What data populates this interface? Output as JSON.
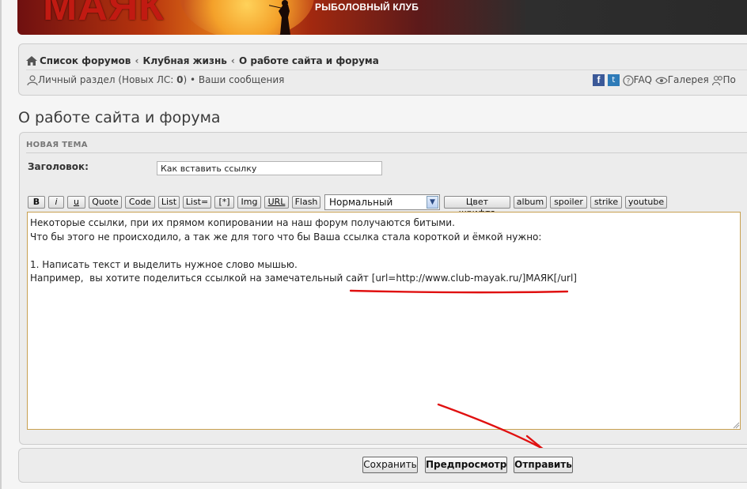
{
  "header": {
    "logo_text": "МАЯК",
    "subtitle": "РЫБОЛОВНЫЙ КЛУБ"
  },
  "breadcrumbs": {
    "items": [
      "Список форумов",
      "Клубная жизнь",
      "О работе сайта и форума"
    ],
    "separator": "‹"
  },
  "userbar": {
    "personal_prefix": "Личный раздел (Новых ЛС: ",
    "new_pm_count": "0",
    "personal_suffix": ")",
    "bullet": "•",
    "my_posts": "Ваши сообщения",
    "faq": "FAQ",
    "gallery": "Галерея",
    "users_truncated": "По"
  },
  "page_title": "О работе сайта и форума",
  "panel": {
    "heading": "НОВАЯ ТЕМА",
    "subject_label": "Заголовок:",
    "subject_value": "Как вставить ссылку"
  },
  "toolbar": {
    "buttons": [
      "B",
      "i",
      "u",
      "Quote",
      "Code",
      "List",
      "List=",
      "[*]",
      "Img",
      "URL",
      "Flash"
    ],
    "font_size_selected": "Нормальный",
    "buttons_after": [
      "Цвет шрифта",
      "album",
      "spoiler",
      "strike",
      "youtube"
    ]
  },
  "editor": {
    "lines": [
      "Некоторые ссылки, при их прямом копировании на наш форум получаются битыми.",
      "Что бы этого не происходило, а так же для того что бы Ваша ссылка стала короткой и ёмкой нужно:",
      "",
      "1. Написать текст и выделить нужное слово мышью.",
      "Например,  вы хотите поделиться ссылкой на замечательный сайт [url=http://www.club-mayak.ru/]МАЯК[/url]"
    ]
  },
  "actions": {
    "save": "Сохранить",
    "preview": "Предпросмотр",
    "submit": "Отправить"
  },
  "colors": {
    "annotation_red": "#e01010",
    "editor_border": "#c8a050"
  }
}
